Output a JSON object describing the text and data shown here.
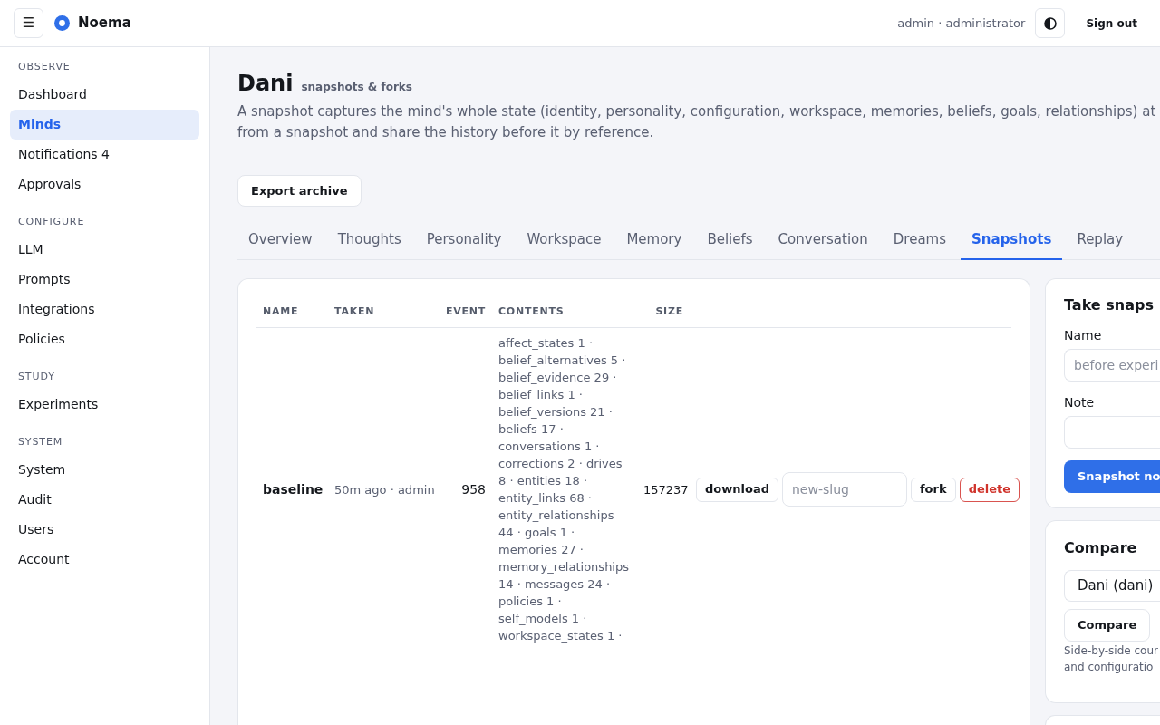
{
  "header": {
    "menu_glyph": "☰",
    "brand": "Noema",
    "user": "admin · administrator",
    "sign_out": "Sign out"
  },
  "sidebar": {
    "sections": [
      {
        "label": "OBSERVE",
        "items": [
          {
            "label": "Dashboard",
            "selected": false
          },
          {
            "label": "Minds",
            "selected": true
          },
          {
            "label": "Notifications 4",
            "selected": false
          },
          {
            "label": "Approvals",
            "selected": false
          }
        ]
      },
      {
        "label": "CONFIGURE",
        "items": [
          {
            "label": "LLM",
            "selected": false
          },
          {
            "label": "Prompts",
            "selected": false
          },
          {
            "label": "Integrations",
            "selected": false
          },
          {
            "label": "Policies",
            "selected": false
          }
        ]
      },
      {
        "label": "STUDY",
        "items": [
          {
            "label": "Experiments",
            "selected": false
          }
        ]
      },
      {
        "label": "SYSTEM",
        "items": [
          {
            "label": "System",
            "selected": false
          },
          {
            "label": "Audit",
            "selected": false
          },
          {
            "label": "Users",
            "selected": false
          },
          {
            "label": "Account",
            "selected": false
          }
        ]
      }
    ]
  },
  "page": {
    "title": "Dani",
    "subtitle": "snapshots & forks",
    "description_lines": [
      "A snapshot captures the mind's whole state (identity, personality, configuration, workspace, memories, beliefs, goals, relationships) at",
      "from a snapshot and share the history before it by reference."
    ],
    "export_button": "Export archive"
  },
  "tabs": [
    {
      "label": "Overview",
      "selected": false
    },
    {
      "label": "Thoughts",
      "selected": false
    },
    {
      "label": "Personality",
      "selected": false
    },
    {
      "label": "Workspace",
      "selected": false
    },
    {
      "label": "Memory",
      "selected": false
    },
    {
      "label": "Beliefs",
      "selected": false
    },
    {
      "label": "Conversation",
      "selected": false
    },
    {
      "label": "Dreams",
      "selected": false
    },
    {
      "label": "Snapshots",
      "selected": true
    },
    {
      "label": "Replay",
      "selected": false
    }
  ],
  "snapshots_table": {
    "columns": [
      "NAME",
      "TAKEN",
      "EVENT",
      "CONTENTS",
      "SIZE"
    ],
    "rows": [
      {
        "name": "baseline",
        "taken": "50m ago · admin",
        "event": "958",
        "contents": "affect_states 1 · belief_alternatives 5 · belief_evidence 29 · belief_links 1 · belief_versions 21 · beliefs 17 · conversations 1 · corrections 2 · drives 8 · entities 18 · entity_links 68 · entity_relationships 44 · goals 1 · memories 27 · memory_relationships 14 · messages 24 · policies 1 · self_models 1 · workspace_states 1 ·",
        "size": "157237",
        "actions": [
          {
            "kind": "button",
            "label": "download"
          },
          {
            "kind": "input",
            "placeholder": "new-slug"
          },
          {
            "kind": "button",
            "label": "fork"
          },
          {
            "kind": "danger",
            "label": "delete"
          }
        ]
      }
    ]
  },
  "take_snapshot": {
    "title": "Take snaps",
    "name_label": "Name",
    "name_placeholder": "before experi",
    "note_label": "Note",
    "button": "Snapshot no"
  },
  "compare": {
    "title": "Compare",
    "select_value": "Dani (dani)",
    "button": "Compare",
    "help_lines": [
      "Side-by-side cour",
      "and configuratio"
    ]
  }
}
